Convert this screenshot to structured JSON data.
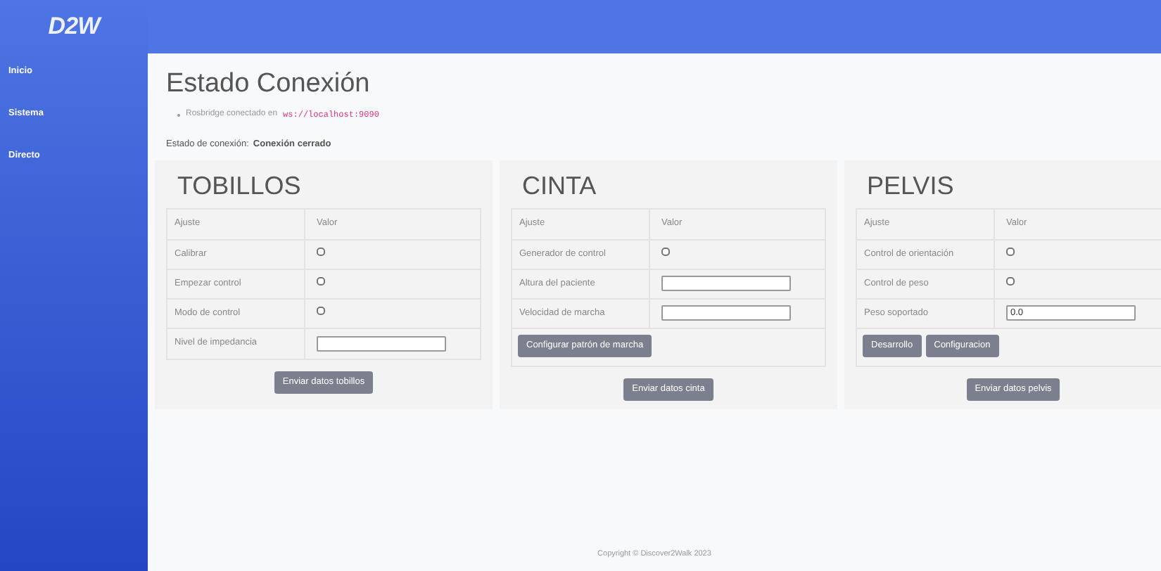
{
  "sidebar": {
    "logo": "D2W",
    "items": [
      {
        "label": "Inicio"
      },
      {
        "label": "Sistema"
      },
      {
        "label": "Directo"
      }
    ]
  },
  "status": {
    "title": "Estado Conexión",
    "bullet": "Rosbridge conectado en",
    "address": "ws://localhost:9090",
    "state_label": "Estado de conexión:",
    "state_value": "Conexión cerrado"
  },
  "panels": [
    {
      "title": "TOBILLOS",
      "columns": [
        "Ajuste",
        "Valor"
      ],
      "rows": [
        {
          "kind": "checkbox",
          "label": "Calibrar",
          "checked": false
        },
        {
          "kind": "checkbox",
          "label": "Empezar control",
          "checked": false
        },
        {
          "kind": "checkbox",
          "label": "Modo de control",
          "checked": false
        },
        {
          "kind": "input",
          "label": "Nivel de impedancia"
        }
      ],
      "send_button": "Enviar datos tobillos"
    },
    {
      "title": "CINTA",
      "columns": [
        "Ajuste",
        "Valor"
      ],
      "rows": [
        {
          "kind": "checkbox",
          "label": "Generador de control",
          "checked": false
        },
        {
          "kind": "input",
          "label": "Altura del paciente"
        },
        {
          "kind": "input",
          "label": "Velocidad de marcha"
        }
      ],
      "buttons": [
        "Configurar patrón de marcha"
      ],
      "send_button": "Enviar datos cinta"
    },
    {
      "title": "PELVIS",
      "columns": [
        "Ajuste",
        "Valor"
      ],
      "rows": [
        {
          "kind": "checkbox",
          "label": "Control de orientación",
          "checked": false
        },
        {
          "kind": "checkbox",
          "label": "Control de peso",
          "checked": false
        },
        {
          "kind": "input",
          "label": "Peso soportado",
          "value": "0.0"
        }
      ],
      "buttons": [
        "Desarrollo",
        "Configuracion"
      ],
      "send_button": "Enviar datos pelvis"
    }
  ],
  "footer": "Copyright © Discover2Walk 2023"
}
